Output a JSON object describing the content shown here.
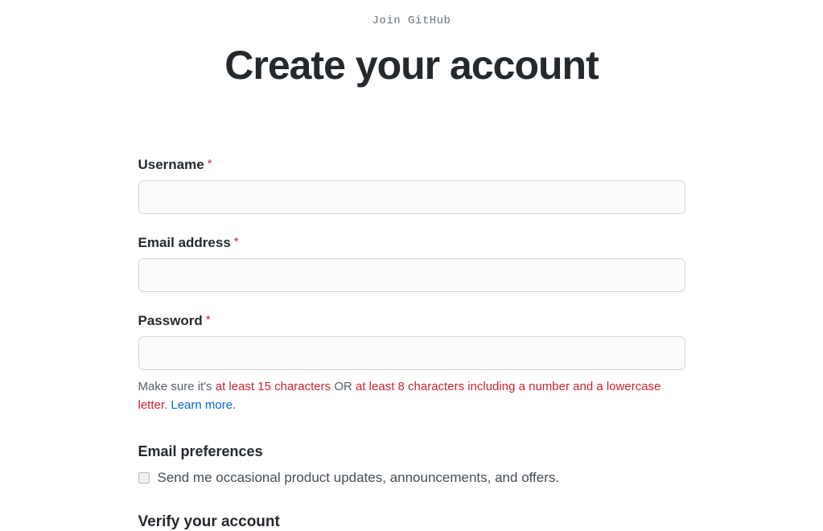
{
  "header": {
    "pre_title": "Join GitHub",
    "title": "Create your account"
  },
  "form": {
    "required_mark": "*",
    "username": {
      "label": "Username",
      "value": ""
    },
    "email": {
      "label": "Email address",
      "value": ""
    },
    "password": {
      "label": "Password",
      "value": "",
      "hint_prefix": "Make sure it's ",
      "hint_rule1": "at least 15 characters",
      "hint_or": " OR ",
      "hint_rule2": "at least 8 characters including a number and a lowercase letter",
      "hint_period": ". ",
      "hint_learn_more": "Learn more",
      "hint_end": "."
    },
    "email_preferences": {
      "heading": "Email preferences",
      "checkbox_label": "Send me occasional product updates, announcements, and offers."
    },
    "verify": {
      "heading": "Verify your account"
    }
  }
}
